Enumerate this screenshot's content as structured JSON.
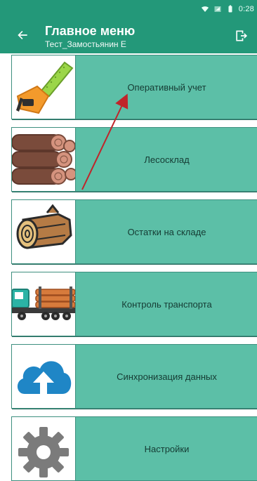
{
  "status_bar": {
    "time": "0:28",
    "icons": [
      "wifi-icon",
      "signal-icon",
      "battery-icon"
    ]
  },
  "app_bar": {
    "title": "Главное меню",
    "subtitle": "Тест_Замостьянин Е",
    "back_icon": "back-arrow-icon",
    "exit_icon": "exit-icon"
  },
  "menu": {
    "items": [
      {
        "label": "Оперативный учет",
        "icon": "chainsaw-icon"
      },
      {
        "label": "Лесосклад",
        "icon": "log-pile-icon"
      },
      {
        "label": "Остатки на складе",
        "icon": "log-icon"
      },
      {
        "label": "Контроль транспорта",
        "icon": "timber-truck-icon"
      },
      {
        "label": "Синхронизация данных",
        "icon": "cloud-upload-icon"
      },
      {
        "label": "Настройки",
        "icon": "gear-icon"
      }
    ]
  },
  "colors": {
    "primary": "#239879",
    "menu_item_bg": "#5cbfa7",
    "menu_text": "#153b33",
    "annotation_arrow": "#c0242a"
  }
}
